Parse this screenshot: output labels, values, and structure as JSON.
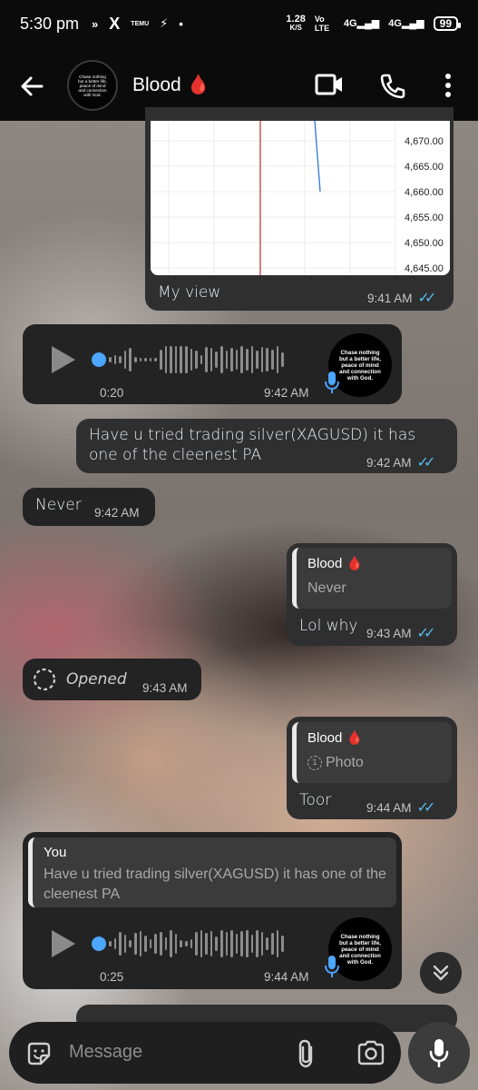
{
  "status_bar": {
    "time": "5:30 pm",
    "indicators": [
      "»",
      "X",
      "TEMU",
      "⚡",
      "•"
    ],
    "net_speed_value": "1.28",
    "net_speed_unit": "K/S",
    "volte": "Vo LTE",
    "signal_1": "4G",
    "signal_2": "4G",
    "battery": "99"
  },
  "header": {
    "contact_name": "Blood 🩸",
    "avatar_text": "Chase nothing but a better life, peace of mind and connection with God."
  },
  "messages": {
    "chart_caption": "My view",
    "chart_caption_time": "9:41 AM",
    "chart_ticks": [
      "4,670.00",
      "4,665.00",
      "4,660.00",
      "4,655.00",
      "4,650.00",
      "4,645.00"
    ],
    "voice1_duration": "0:20",
    "voice1_time": "9:42 AM",
    "silver_text": "Have u tried trading silver(XAGUSD) it has one of the cleenest PA",
    "silver_time": "9:42 AM",
    "never_text": "Never",
    "never_time": "9:42 AM",
    "reply1_quote_name": "Blood 🩸",
    "reply1_quote_text": "Never",
    "reply1_text": "Lol why",
    "reply1_time": "9:43 AM",
    "opened_text": "Opened",
    "opened_time": "9:43 AM",
    "reply2_quote_name": "Blood 🩸",
    "reply2_quote_text": "Photo",
    "reply2_text": "Toor",
    "reply2_time": "9:44 AM",
    "reply3_quote_name": "You",
    "reply3_quote_text": "Have u tried trading silver(XAGUSD) it has one of the cleenest PA",
    "voice2_duration": "0:25",
    "voice2_time": "9:44 AM"
  },
  "input": {
    "placeholder": "Message"
  },
  "colors": {
    "header_bg": "#0b0b0b",
    "bubble_in": "#232323",
    "bubble_out": "#2f2f30",
    "read_ticks": "#53bdeb",
    "voice_dot": "#4da6ff"
  }
}
